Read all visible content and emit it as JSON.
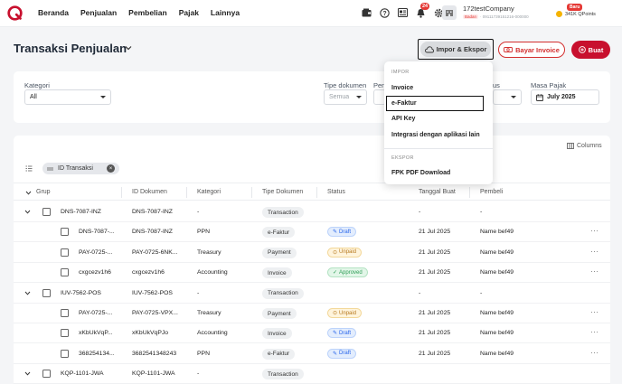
{
  "nav": {
    "items": [
      "Beranda",
      "Penjualan",
      "Pembelian",
      "Pajak",
      "Lainnya"
    ],
    "notification_count": "24",
    "company_name": "172testCompany",
    "company_type": "Badan",
    "company_id": "· 09111739151216-000000",
    "points_badge": "Baru",
    "points": "341K QPoints"
  },
  "header": {
    "title": "Transaksi Penjualan",
    "impor_label": "Impor & Ekspor",
    "bayar_label": "Bayar Invoice",
    "buat_label": "Buat"
  },
  "filters": {
    "kategori_label": "Kategori",
    "kategori_value": "All",
    "tipe_label": "Tipe dokumen",
    "tipe_placeholder": "Semua",
    "pen_label": "Pen",
    "status_label": "us",
    "masa_label": "Masa Pajak",
    "masa_value": "July 2025"
  },
  "table": {
    "columns_label": "Columns",
    "chip_label": "ID Transaksi",
    "headers": [
      "Grup",
      "ID Dokumen",
      "Kategori",
      "Tipe Dokumen",
      "Status",
      "Tanggal Buat",
      "Pembeli"
    ],
    "rows": [
      {
        "group": true,
        "grup": "DNS-7087-INZ",
        "id": "DNS-7087-INZ",
        "kategori": "-",
        "tipe": "Transaction",
        "status": "",
        "tanggal": "-",
        "pembeli": "-"
      },
      {
        "group": false,
        "grup": "DNS-7087-...",
        "id": "DNS-7087-INZ",
        "kategori": "PPN",
        "tipe": "e-Faktur",
        "status": "Draft",
        "tanggal": "21 Jul 2025",
        "pembeli": "Name bef49"
      },
      {
        "group": false,
        "grup": "PAY-0725-...",
        "id": "PAY-0725-6NK...",
        "kategori": "Treasury",
        "tipe": "Payment",
        "status": "Unpaid",
        "tanggal": "21 Jul 2025",
        "pembeli": "Name bef49"
      },
      {
        "group": false,
        "grup": "cxgcezv1h6",
        "id": "cxgcezv1h6",
        "kategori": "Accounting",
        "tipe": "Invoice",
        "status": "Approved",
        "tanggal": "21 Jul 2025",
        "pembeli": "Name bef49"
      },
      {
        "group": true,
        "grup": "IUV-7562-POS",
        "id": "IUV-7562-POS",
        "kategori": "-",
        "tipe": "Transaction",
        "status": "",
        "tanggal": "-",
        "pembeli": "-"
      },
      {
        "group": false,
        "grup": "PAY-0725-...",
        "id": "PAY-0725-VPX...",
        "kategori": "Treasury",
        "tipe": "Payment",
        "status": "Unpaid",
        "tanggal": "21 Jul 2025",
        "pembeli": "Name bef49"
      },
      {
        "group": false,
        "grup": "xKbUkVqP...",
        "id": "xKbUkVqPJo",
        "kategori": "Accounting",
        "tipe": "Invoice",
        "status": "Draft",
        "tanggal": "21 Jul 2025",
        "pembeli": "Name bef49"
      },
      {
        "group": false,
        "grup": "368254134...",
        "id": "3682541348243",
        "kategori": "PPN",
        "tipe": "e-Faktur",
        "status": "Draft",
        "tanggal": "21 Jul 2025",
        "pembeli": "Name bef49"
      },
      {
        "group": true,
        "grup": "KQP-1101-JWA",
        "id": "KQP-1101-JWA",
        "kategori": "-",
        "tipe": "Transaction",
        "status": "",
        "tanggal": "",
        "pembeli": ""
      }
    ]
  },
  "dropdown": {
    "impor_section": "IMPOR",
    "ekspor_section": "EKSPOR",
    "items": [
      "Invoice",
      "e-Faktur",
      "API Key",
      "Integrasi dengan aplikasi lain"
    ],
    "ekspor_items": [
      "FPK PDF Download"
    ]
  },
  "colors": {
    "brand": "#c8102e",
    "draft": "#2563eb",
    "unpaid": "#b7791f",
    "approved": "#2f9e57"
  }
}
